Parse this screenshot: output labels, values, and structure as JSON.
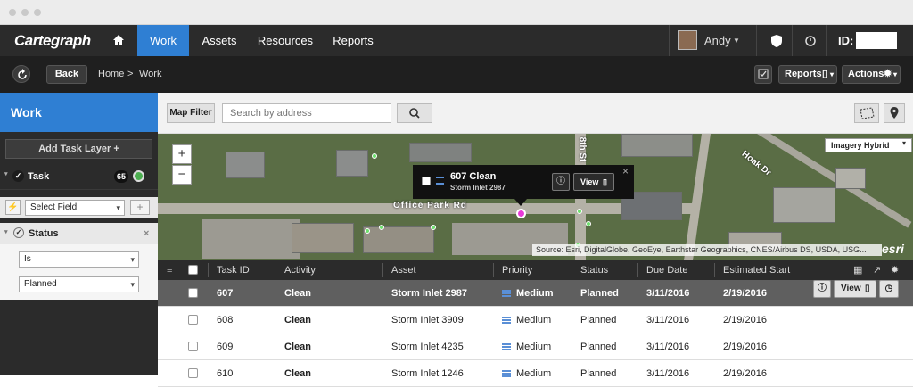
{
  "app": {
    "logo": "Cartegraph"
  },
  "topnav": {
    "items": [
      "Work",
      "Assets",
      "Resources",
      "Reports"
    ],
    "active": "Work",
    "user": "Andy",
    "id_label": "ID:"
  },
  "subnav": {
    "back_label": "Back",
    "breadcrumb": [
      "Home",
      ">",
      "Work"
    ],
    "reports_label": "Reports",
    "actions_label": "Actions"
  },
  "sidebar": {
    "title": "Work",
    "add_task_layer": "Add Task Layer +",
    "task_label": "Task",
    "task_count": "65",
    "select_field": "Select Field",
    "add_symbol": "+",
    "status_label": "Status",
    "operator": "Is",
    "value": "Planned"
  },
  "toolbar": {
    "map_filter": "Map Filter",
    "search_placeholder": "Search by address"
  },
  "map": {
    "basemap": "Imagery Hybrid",
    "zoom_in": "+",
    "zoom_out": "−",
    "road_label_1": "Office Park Rd",
    "road_label_2": "Hoak Dr",
    "road_label_3": "8th St",
    "popup": {
      "title": "607 Clean",
      "subtitle": "Storm Inlet 2987",
      "view": "View"
    },
    "attribution": "Source: Esri, DigitalGlobe, GeoEye, Earthstar Geographics, CNES/Airbus DS, USDA, USG...",
    "esri": "esri"
  },
  "grid": {
    "columns": [
      "Task ID",
      "Activity",
      "Asset",
      "Priority",
      "Status",
      "Due Date",
      "Estimated Start D"
    ],
    "view_label": "View",
    "rows": [
      {
        "task_id": "607",
        "activity": "Clean",
        "asset": "Storm Inlet 2987",
        "priority": "Medium",
        "status": "Planned",
        "due": "3/11/2016",
        "start": "2/19/2016"
      },
      {
        "task_id": "608",
        "activity": "Clean",
        "asset": "Storm Inlet 3909",
        "priority": "Medium",
        "status": "Planned",
        "due": "3/11/2016",
        "start": "2/19/2016"
      },
      {
        "task_id": "609",
        "activity": "Clean",
        "asset": "Storm Inlet 4235",
        "priority": "Medium",
        "status": "Planned",
        "due": "3/11/2016",
        "start": "2/19/2016"
      },
      {
        "task_id": "610",
        "activity": "Clean",
        "asset": "Storm Inlet 1246",
        "priority": "Medium",
        "status": "Planned",
        "due": "3/11/2016",
        "start": "2/19/2016"
      }
    ]
  },
  "colors": {
    "accent": "#2f7fd3",
    "dark": "#2b2b2b",
    "priority": "#5a8fd6",
    "marker": "#e83ad8",
    "online": "#4caf50"
  }
}
